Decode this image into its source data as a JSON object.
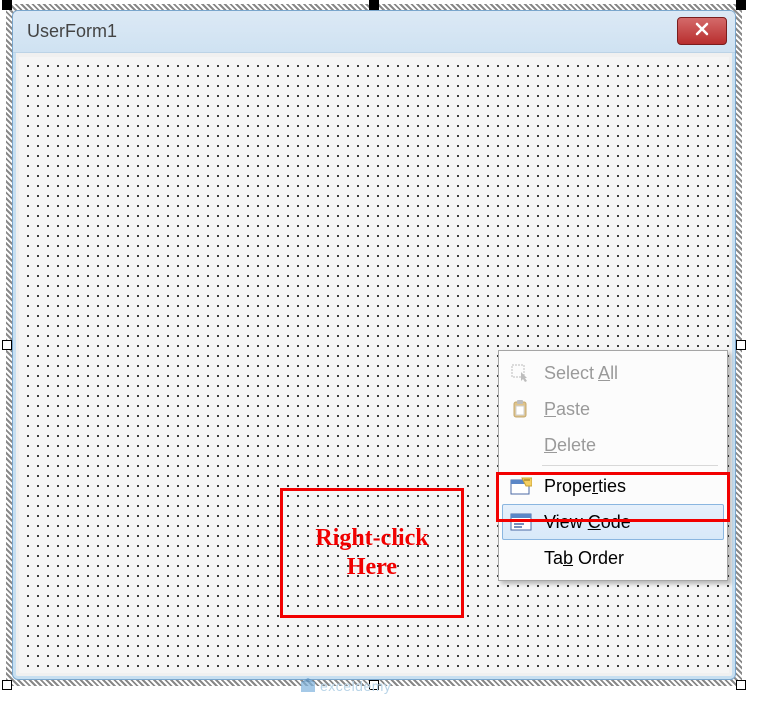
{
  "form": {
    "title": "UserForm1"
  },
  "annotation": {
    "line1": "Right-click",
    "line2": "Here"
  },
  "contextMenu": {
    "selectAll": "Select All",
    "paste": "Paste",
    "delete": "Delete",
    "properties": "Properties",
    "viewCode": "View Code",
    "tabOrder": "Tab Order"
  },
  "watermark": {
    "text": "exceldemy"
  }
}
